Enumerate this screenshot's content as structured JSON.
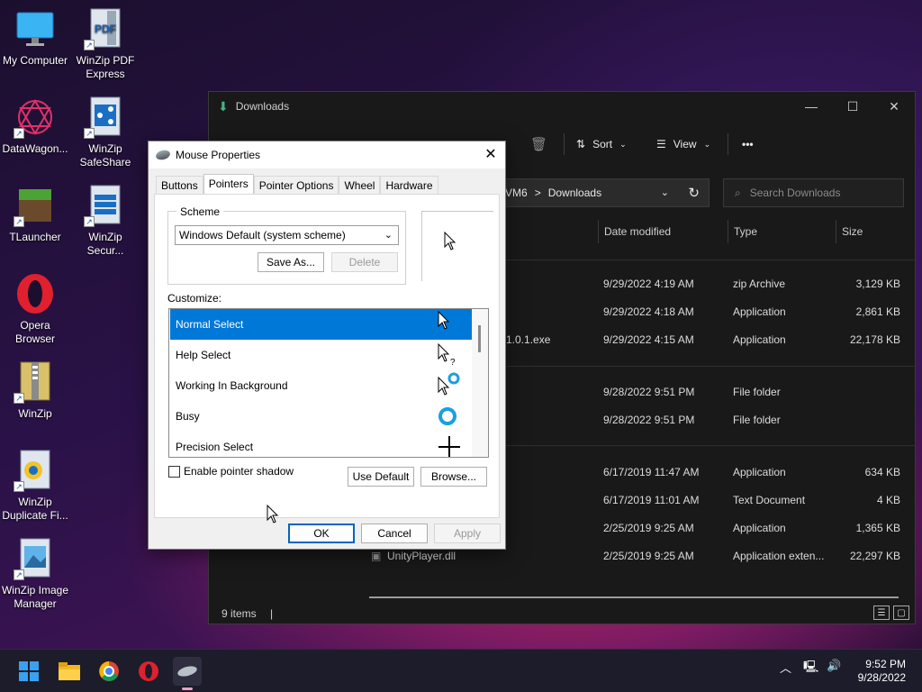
{
  "desktop": {
    "icons": [
      {
        "label": "My Computer",
        "icon": "monitor-icon"
      },
      {
        "label": "WinZip PDF Express",
        "icon": "winzip-pdf-icon"
      },
      {
        "label": "DataWagon...",
        "icon": "datawagon-icon"
      },
      {
        "label": "WinZip SafeShare",
        "icon": "winzip-safeshare-icon"
      },
      {
        "label": "TLauncher",
        "icon": "tlauncher-icon"
      },
      {
        "label": "WinZip Secur...",
        "icon": "winzip-secure-icon"
      },
      {
        "label": "Opera Browser",
        "icon": "opera-icon"
      },
      {
        "label": "WinZip",
        "icon": "winzip-icon"
      },
      {
        "label": "WinZip Duplicate Fi...",
        "icon": "winzip-duplicate-icon"
      },
      {
        "label": "WinZip Image Manager",
        "icon": "winzip-image-icon"
      }
    ]
  },
  "explorer": {
    "title": "Downloads",
    "toolbar": {
      "sort_label": "Sort",
      "view_label": "View",
      "more_label": "•••"
    },
    "address": {
      "path_prefix": "VM6",
      "path_sep": ">",
      "path_current": "Downloads"
    },
    "search": {
      "placeholder": "Search Downloads"
    },
    "columns": {
      "date": "Date modified",
      "type": "Type",
      "size": "Size"
    },
    "rows": [
      {
        "name": "",
        "date": "9/29/2022 4:19 AM",
        "type": "zip Archive",
        "size": "3,129 KB"
      },
      {
        "name": "",
        "date": "9/29/2022 4:18 AM",
        "type": "Application",
        "size": "2,861 KB"
      },
      {
        "name": "1.0.1.exe",
        "date": "9/29/2022 4:15 AM",
        "type": "Application",
        "size": "22,178 KB"
      },
      {
        "name": "",
        "date": "9/28/2022 9:51 PM",
        "type": "File folder",
        "size": ""
      },
      {
        "name": "",
        "date": "9/28/2022 9:51 PM",
        "type": "File folder",
        "size": ""
      },
      {
        "name": "",
        "date": "6/17/2019 11:47 AM",
        "type": "Application",
        "size": "634 KB"
      },
      {
        "name": "",
        "date": "6/17/2019 11:01 AM",
        "type": "Text Document",
        "size": "4 KB"
      },
      {
        "name": "",
        "date": "2/25/2019 9:25 AM",
        "type": "Application",
        "size": "1,365 KB"
      },
      {
        "name": "UnityPlayer.dll",
        "date": "2/25/2019 9:25 AM",
        "type": "Application exten...",
        "size": "22,297 KB"
      }
    ],
    "status": "9 items"
  },
  "dialog": {
    "title": "Mouse Properties",
    "tabs": [
      "Buttons",
      "Pointers",
      "Pointer Options",
      "Wheel",
      "Hardware"
    ],
    "active_tab": "Pointers",
    "scheme_label": "Scheme",
    "scheme_value": "Windows Default (system scheme)",
    "save_as": "Save As...",
    "delete": "Delete",
    "customize_label": "Customize:",
    "cursors": [
      {
        "label": "Normal Select",
        "glyph": "arrow"
      },
      {
        "label": "Help Select",
        "glyph": "arrow-question"
      },
      {
        "label": "Working In Background",
        "glyph": "arrow-busy"
      },
      {
        "label": "Busy",
        "glyph": "busy-ring"
      },
      {
        "label": "Precision Select",
        "glyph": "crosshair"
      }
    ],
    "selected_cursor": "Normal Select",
    "shadow_label": "Enable pointer shadow",
    "use_default": "Use Default",
    "browse": "Browse...",
    "ok": "OK",
    "cancel": "Cancel",
    "apply": "Apply"
  },
  "taskbar": {
    "apps": [
      "start-icon",
      "file-explorer-icon",
      "chrome-icon",
      "opera-icon",
      "mouse-properties-icon"
    ],
    "time": "9:52 PM",
    "date": "9/28/2022"
  },
  "colors": {
    "accent": "#0078d7",
    "explorer_bg": "#191919",
    "taskbar_bg": "#1c1c2a"
  }
}
